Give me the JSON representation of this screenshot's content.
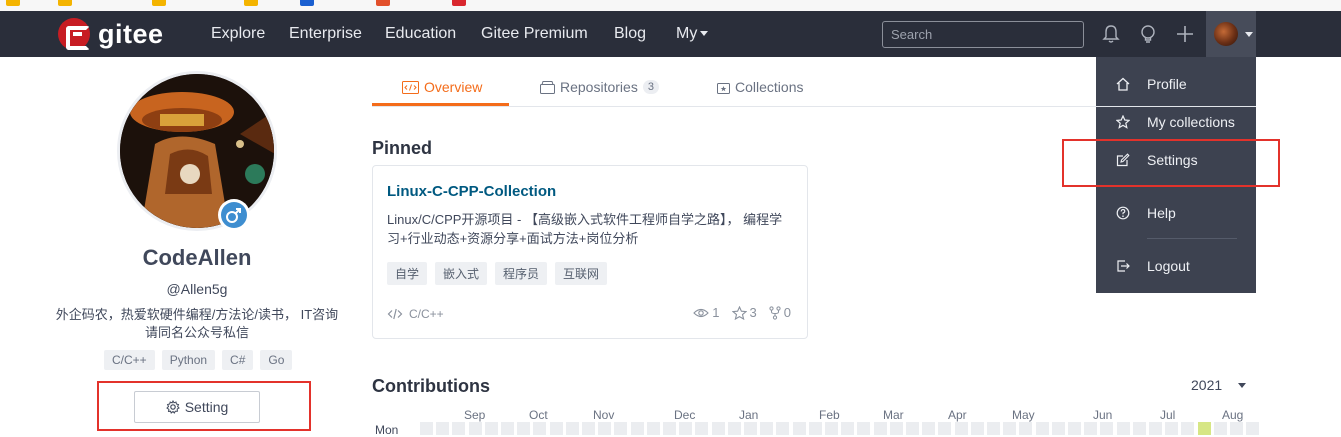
{
  "nav": {
    "brand": "gitee",
    "links": [
      "Explore",
      "Enterprise",
      "Education",
      "Gitee Premium",
      "Blog"
    ],
    "my_label": "My",
    "search_placeholder": "Search"
  },
  "dropdown": {
    "items": [
      "Profile",
      "My collections",
      "Settings",
      "Help",
      "Logout"
    ]
  },
  "profile": {
    "name": "CodeAllen",
    "handle": "@Allen5g",
    "bio": "外企码农，热爱软硬件编程/方法论/读书， IT咨询请同名公众号私信",
    "tags": [
      "C/C++",
      "Python",
      "C#",
      "Go"
    ],
    "setting_label": "Setting"
  },
  "tabs": {
    "overview": "Overview",
    "repositories": "Repositories",
    "repositories_count": "3",
    "collections": "Collections"
  },
  "pinned": {
    "heading": "Pinned",
    "repo": {
      "name": "Linux-C-CPP-Collection",
      "description": "Linux/C/CPP开源项目 - 【高级嵌入式软件工程师自学之路】， 编程学习+行业动态+资源分享+面试方法+岗位分析",
      "tags": [
        "自学",
        "嵌入式",
        "程序员",
        "互联网"
      ],
      "language": "C/C++",
      "watchers": "1",
      "stars": "3",
      "forks": "0"
    }
  },
  "contributions": {
    "heading": "Contributions",
    "year": "2021",
    "months": [
      "Sep",
      "Oct",
      "Nov",
      "Dec",
      "Jan",
      "Feb",
      "Mar",
      "Apr",
      "May",
      "Jun",
      "Jul",
      "Aug"
    ],
    "weekday_label": "Mon"
  },
  "colors": {
    "nav_bg": "#2a2e3a",
    "dropdown_bg": "#3d4250",
    "accent_orange": "#f46c1a",
    "repo_link": "#005980",
    "highlight_box": "#e3322b",
    "brand_red": "#c71d23",
    "contribution_active": "#d6e685"
  }
}
